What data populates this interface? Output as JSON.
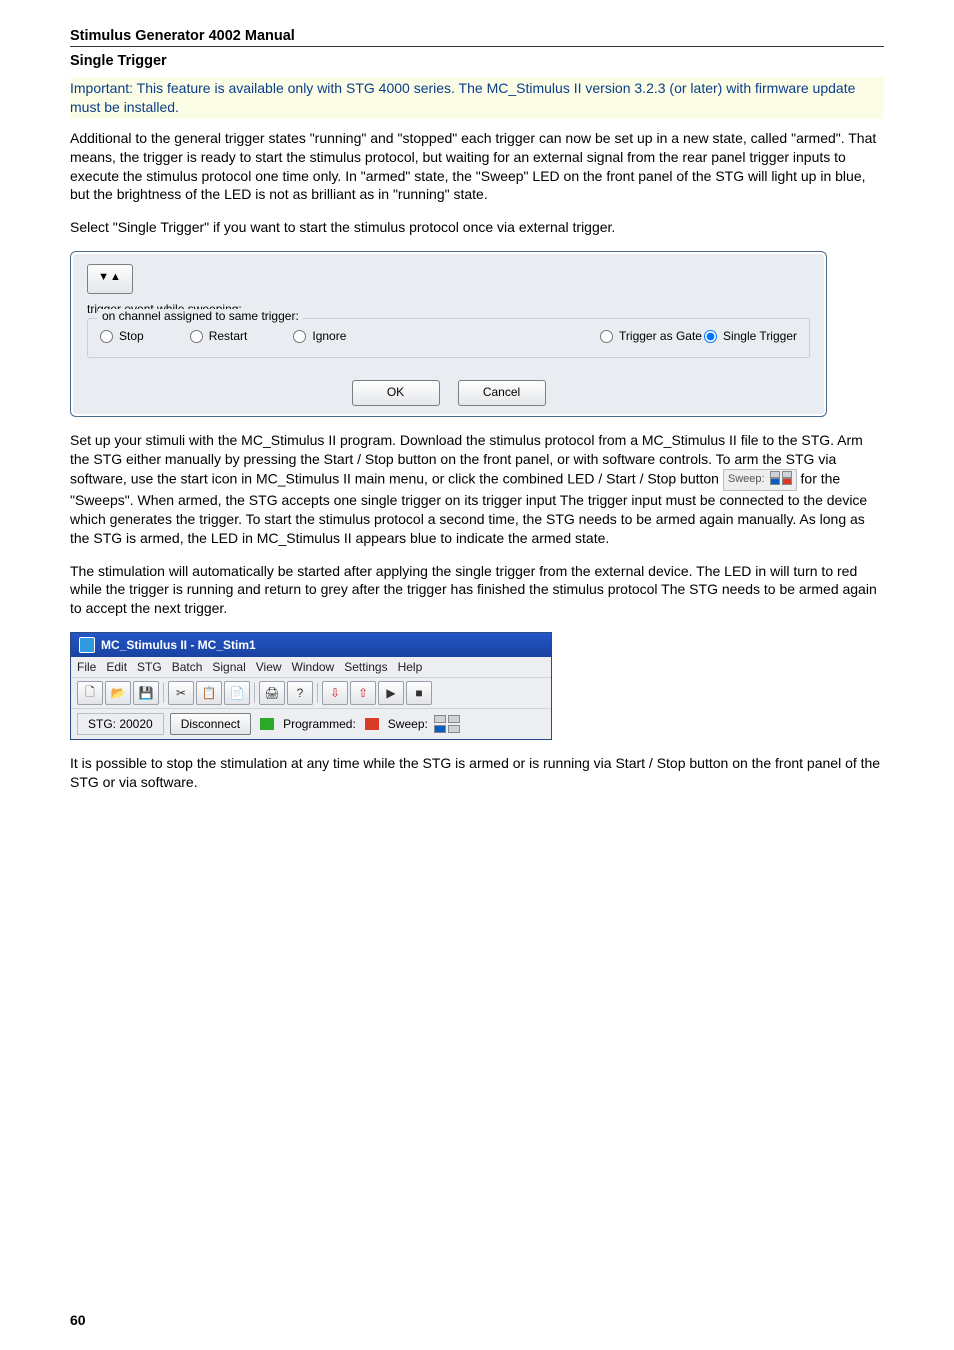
{
  "doc_title": "Stimulus Generator 4002 Manual",
  "section_title": "Single Trigger",
  "important_text": "Important: This feature is available only with STG 4000 series. The MC_Stimulus II version 3.2.3 (or later) with firmware update must be installed.",
  "para1": "Additional to the general trigger states \"running\" and \"stopped\" each trigger can now be set up in a new state, called \"armed\". That means, the trigger is ready to start the stimulus protocol, but waiting for an external signal from the rear panel trigger inputs to execute the stimulus protocol one time only. In \"armed\" state, the \"Sweep\" LED on the front panel of the STG will light up in blue, but the brightness of the LED is not as brilliant as in \"running\" state.",
  "para2": "Select \"Single Trigger\" if you want to start the stimulus protocol once via external trigger.",
  "dialog1": {
    "sort_btn_label": "▼▲",
    "caption": "trigger event while sweeping:",
    "group_legend": "on channel assigned to same trigger:",
    "radios": {
      "stop": "Stop",
      "restart": "Restart",
      "ignore": "Ignore",
      "gate": "Trigger as Gate",
      "single": "Single Trigger"
    },
    "ok": "OK",
    "cancel": "Cancel"
  },
  "para3a": "Set up your stimuli with the MC_Stimulus II program. Download the stimulus protocol from a MC_Stimulus II file to the STG. Arm the STG either manually by pressing the Start / Stop button on the front panel, or with software controls. To arm the STG via software, use the start icon in MC_Stimulus II main menu, or click the combined LED / Start / Stop button ",
  "sweep_label": "Sweep:",
  "para3b": " for the \"Sweeps\". When armed, the STG accepts one single trigger on its trigger input The trigger input must be connected to the device which generates the trigger. To start the stimulus protocol a second time, the STG needs to be armed again manually. As long as the STG is armed, the LED in MC_Stimulus II appears blue to indicate the armed state.",
  "para4": "The stimulation will automatically be started after applying the single trigger from the external device. The LED in will turn to red while the trigger is running and return to grey after the trigger has finished the stimulus protocol The STG needs to be armed again to accept the next trigger.",
  "app": {
    "title": "MC_Stimulus II - MC_Stim1",
    "menu": [
      "File",
      "Edit",
      "STG",
      "Batch",
      "Signal",
      "View",
      "Window",
      "Settings",
      "Help"
    ],
    "stg_label": "STG: 20020",
    "disconnect": "Disconnect",
    "programmed": "Programmed:",
    "sweep": "Sweep:"
  },
  "para5": "It is possible to stop the stimulation at any time while the STG is armed or is running via Start / Stop button on the front panel of the STG or via software.",
  "pagenum": "60"
}
